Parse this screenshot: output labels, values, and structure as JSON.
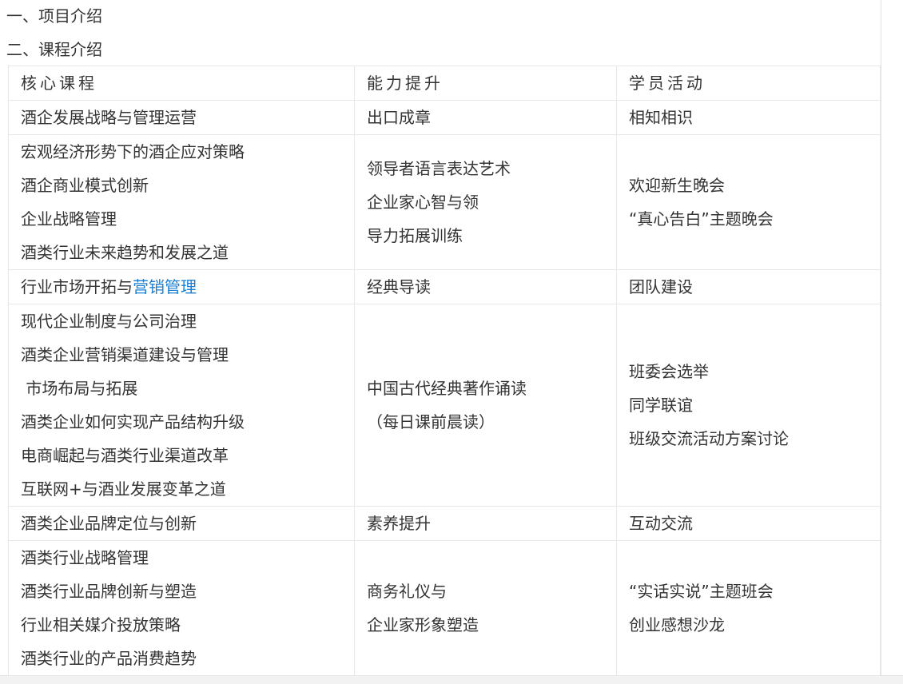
{
  "headings": [
    "一、项目介绍",
    "二、课程介绍"
  ],
  "table": {
    "headers": [
      "核心课程",
      "能力提升",
      "学员活动"
    ],
    "rows": [
      {
        "core": [
          "酒企发展战略与管理运营"
        ],
        "ability": [
          "出口成章"
        ],
        "activity": [
          "相知相识"
        ]
      },
      {
        "core": [
          "宏观经济形势下的酒企应对策略",
          "酒企商业模式创新",
          "企业战略管理",
          "酒类行业未来趋势和发展之道"
        ],
        "ability": [
          "领导者语言表达艺术",
          "企业家心智与领",
          "导力拓展训练"
        ],
        "activity": [
          "欢迎新生晚会",
          "“真心告白”主题晚会"
        ]
      },
      {
        "core_prefix": "行业市场开拓与",
        "core_link": "营销管理",
        "ability": [
          "经典导读"
        ],
        "activity": [
          "团队建设"
        ]
      },
      {
        "core": [
          "现代企业制度与公司治理",
          "酒类企业营销渠道建设与管理",
          " 市场布局与拓展",
          "酒类企业如何实现产品结构升级",
          "电商崛起与酒类行业渠道改革",
          "互联网+与酒业发展变革之道"
        ],
        "ability": [
          "中国古代经典著作诵读",
          "（每日课前晨读）"
        ],
        "activity": [
          "班委会选举",
          "同学联谊",
          "班级交流活动方案讨论"
        ]
      },
      {
        "core": [
          "酒类企业品牌定位与创新"
        ],
        "ability": [
          "素养提升"
        ],
        "activity": [
          "互动交流"
        ]
      },
      {
        "core": [
          "酒类行业战略管理",
          "酒类行业品牌创新与塑造",
          "行业相关媒介投放策略",
          "酒类行业的产品消费趋势"
        ],
        "ability": [
          "商务礼仪与",
          "企业家形象塑造"
        ],
        "activity": [
          "“实话实说”主题班会",
          "创业感想沙龙"
        ]
      }
    ]
  }
}
